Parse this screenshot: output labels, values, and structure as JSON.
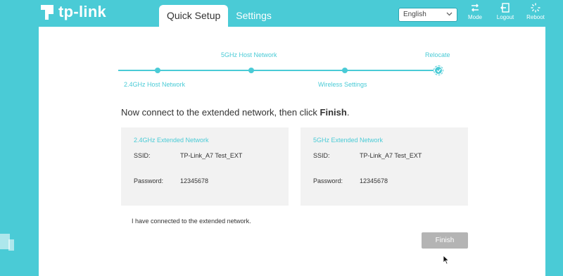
{
  "brand": {
    "name": "tp-link"
  },
  "tabs": [
    {
      "label": "Quick Setup",
      "active": true
    },
    {
      "label": "Settings",
      "active": false
    }
  ],
  "language": {
    "selected": "English"
  },
  "header_buttons": [
    {
      "label": "Mode",
      "icon": "mode-icon"
    },
    {
      "label": "Logout",
      "icon": "logout-icon"
    },
    {
      "label": "Reboot",
      "icon": "reboot-icon"
    }
  ],
  "steps": [
    {
      "label": "2.4GHz Host Network"
    },
    {
      "label": "5GHz Host Network"
    },
    {
      "label": "Wireless Settings"
    },
    {
      "label": "Relocate"
    }
  ],
  "instruction": {
    "text": "Now connect to the extended network, then click ",
    "bold": "Finish",
    "end": "."
  },
  "networks": [
    {
      "title": "2.4GHz Extended Network",
      "ssid_label": "SSID:",
      "ssid": "TP-Link_A7 Test_EXT",
      "password_label": "Password:",
      "password": "12345678"
    },
    {
      "title": "5GHz Extended Network",
      "ssid_label": "SSID:",
      "ssid": "TP-Link_A7 Test_EXT",
      "password_label": "Password:",
      "password": "12345678"
    }
  ],
  "confirm_text": "I have connected to the extended network.",
  "finish_label": "Finish",
  "colors": {
    "accent": "#4acbd6",
    "card_bg": "#f2f2f2",
    "disabled_button": "#b4b4b4"
  }
}
